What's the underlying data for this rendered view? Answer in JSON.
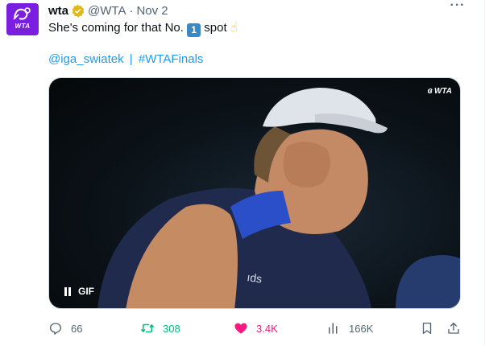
{
  "account": {
    "avatar_text": "WTA",
    "name": "wta",
    "handle": "@WTA",
    "dot": "·",
    "time": "Nov 2"
  },
  "more_label": "···",
  "tweet": {
    "text_before": "She's coming for that No.",
    "keycap": "1",
    "text_after": "spot",
    "emoji": "☝"
  },
  "hashtags": {
    "mention": "@iga_swiatek",
    "separator": "|",
    "hashtag": "#WTAFinals"
  },
  "media": {
    "watermark": "WTA",
    "badge": "GIF"
  },
  "actions": {
    "replies": "66",
    "retweets": "308",
    "likes": "3.4K",
    "views": "166K"
  },
  "colors": {
    "accent": "#1d9bf0",
    "retweet": "#00ba7c",
    "like": "#f91880",
    "brand": "#7a1fe0",
    "verified": "#e2b719"
  },
  "icons": [
    "wta-logo-icon",
    "verified-badge-icon",
    "more-icon",
    "pause-icon",
    "reply-icon",
    "retweet-icon",
    "heart-icon",
    "views-icon",
    "bookmark-icon",
    "share-icon"
  ]
}
